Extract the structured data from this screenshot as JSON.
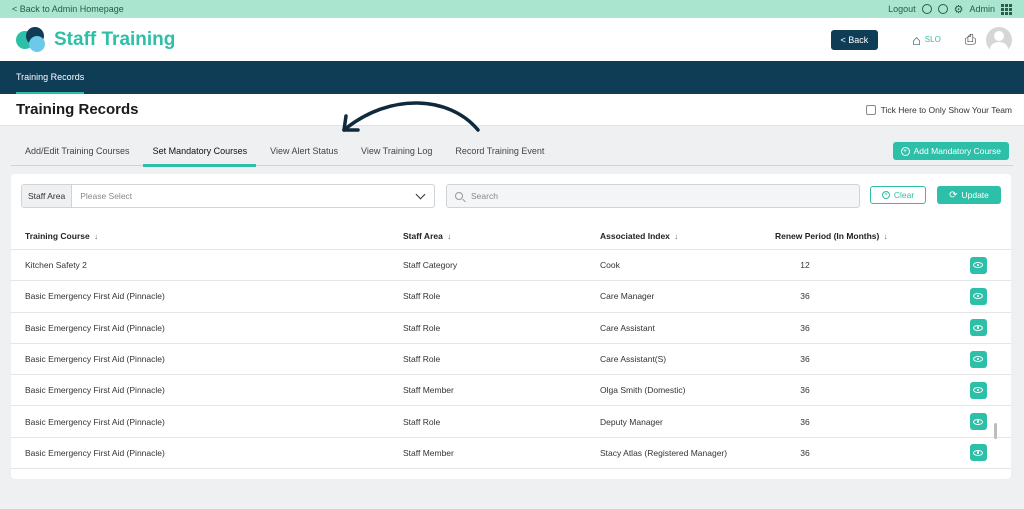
{
  "topbar": {
    "back_link": "< Back to Admin Homepage",
    "logout": "Logout",
    "admin": "Admin"
  },
  "header": {
    "brand": "Staff Training",
    "back_button": "< Back",
    "location": "SLO"
  },
  "nav": {
    "items": [
      {
        "label": "Training Records"
      }
    ]
  },
  "page": {
    "title": "Training Records",
    "only_team_label": "Tick Here to Only Show Your Team"
  },
  "tabs": [
    {
      "label": "Add/Edit Training Courses"
    },
    {
      "label": "Set Mandatory Courses"
    },
    {
      "label": "View Alert Status"
    },
    {
      "label": "View Training Log"
    },
    {
      "label": "Record Training Event"
    }
  ],
  "add_mandatory_button": "Add Mandatory Course",
  "filters": {
    "staff_area_label": "Staff Area",
    "staff_area_placeholder": "Please Select",
    "search_placeholder": "Search",
    "clear": "Clear",
    "update": "Update"
  },
  "table": {
    "headers": [
      "Training Course",
      "Staff Area",
      "Associated Index",
      "Renew Period (In Months)"
    ],
    "rows": [
      [
        "Kitchen Safety 2",
        "Staff Category",
        "Cook",
        "12"
      ],
      [
        "Basic Emergency First Aid (Pinnacle)",
        "Staff Role",
        "Care Manager",
        "36"
      ],
      [
        "Basic Emergency First Aid (Pinnacle)",
        "Staff Role",
        "Care Assistant",
        "36"
      ],
      [
        "Basic Emergency First Aid (Pinnacle)",
        "Staff Role",
        "Care Assistant(S)",
        "36"
      ],
      [
        "Basic Emergency First Aid (Pinnacle)",
        "Staff Member",
        "Olga Smith (Domestic)",
        "36"
      ],
      [
        "Basic Emergency First Aid (Pinnacle)",
        "Staff Role",
        "Deputy Manager",
        "36"
      ],
      [
        "Basic Emergency First Aid (Pinnacle)",
        "Staff Member",
        "Stacy Atlas (Registered Manager)",
        "36"
      ]
    ]
  },
  "colors": {
    "accent": "#2dbfa8",
    "navy": "#0f3d56",
    "topstrip": "#a9e5cf"
  }
}
